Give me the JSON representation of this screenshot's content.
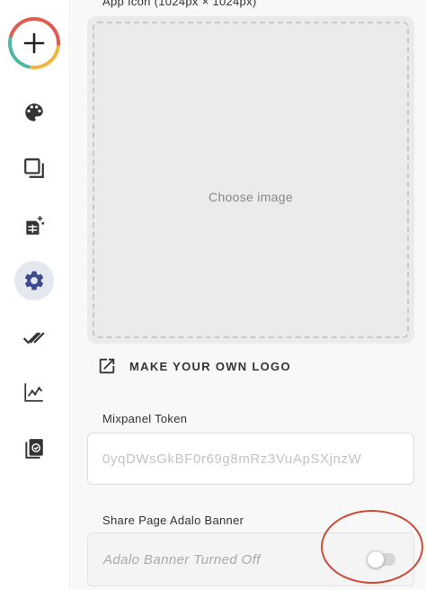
{
  "sidebar": {
    "add_button": "add-icon",
    "items": [
      {
        "icon": "palette-icon"
      },
      {
        "icon": "screens-icon"
      },
      {
        "icon": "database-icon"
      },
      {
        "icon": "gear-icon",
        "active": true
      },
      {
        "icon": "double-check-icon"
      },
      {
        "icon": "analytics-icon"
      },
      {
        "icon": "publish-icon"
      }
    ]
  },
  "app_icon": {
    "label": "App Icon (1024px × 1024px)",
    "choose_label": "Choose image"
  },
  "logo_link": {
    "label": "MAKE YOUR OWN LOGO"
  },
  "mixpanel": {
    "label": "Mixpanel Token",
    "value": "0yqDWsGkBF0r69g8mRz3VuApSXjnzW"
  },
  "share_banner": {
    "label": "Share Page Adalo Banner",
    "status_text": "Adalo Banner Turned Off",
    "enabled": false
  },
  "colors": {
    "accent": "#3d4a8f",
    "annotation": "#cc4a38"
  }
}
